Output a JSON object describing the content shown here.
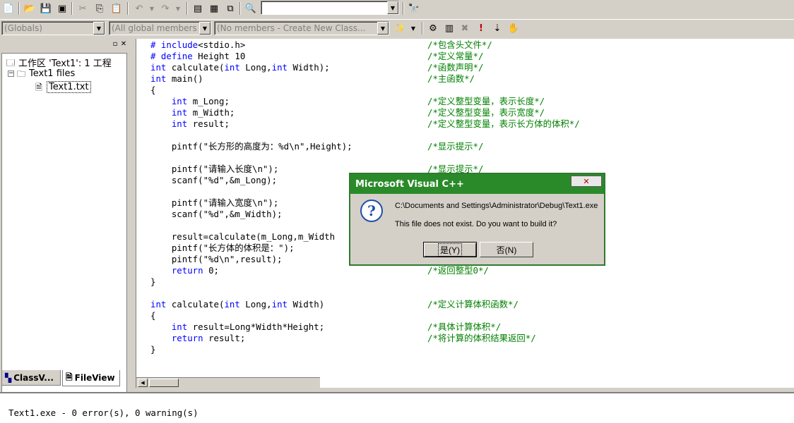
{
  "toolbar1": {
    "buttons": [
      {
        "name": "new-text-file-icon",
        "glyph": "📄"
      },
      {
        "name": "open-icon",
        "glyph": "📂"
      },
      {
        "name": "save-icon",
        "glyph": "💾"
      },
      {
        "name": "save-all-icon",
        "glyph": "▣"
      },
      {
        "name": "cut-icon",
        "glyph": "✂"
      },
      {
        "name": "copy-icon",
        "glyph": "⎘"
      },
      {
        "name": "paste-icon",
        "glyph": "📋"
      },
      {
        "name": "undo-icon",
        "glyph": "↶"
      },
      {
        "name": "redo-icon",
        "glyph": "↷"
      },
      {
        "name": "workspace-icon",
        "glyph": "▤"
      },
      {
        "name": "output-icon",
        "glyph": "▦"
      },
      {
        "name": "window-list-icon",
        "glyph": "⧉"
      },
      {
        "name": "find-in-files-icon",
        "glyph": "🔍"
      },
      {
        "name": "find-icon",
        "glyph": "🔭"
      }
    ],
    "find_combo_value": ""
  },
  "toolbar2": {
    "globals_combo": "(Globals)",
    "members_combo": "(All global members",
    "class_combo": "(No members - Create New Class...",
    "buttons": [
      {
        "name": "compile-icon",
        "glyph": "⚙"
      },
      {
        "name": "build-icon",
        "glyph": "▥"
      },
      {
        "name": "stop-build-icon",
        "glyph": "✖"
      },
      {
        "name": "execute-icon",
        "glyph": "!"
      },
      {
        "name": "go-icon",
        "glyph": "⇣"
      },
      {
        "name": "breakpoint-icon",
        "glyph": "✋"
      }
    ]
  },
  "workspace": {
    "root_label": "工作区 'Text1': 1 工程",
    "project_label": "Text1 files",
    "file_label": "Text1.txt",
    "tabs": [
      "ClassV...",
      "FileView"
    ]
  },
  "code": [
    {
      "segments": [
        {
          "t": "# include",
          "c": "kw"
        },
        {
          "t": "<stdio.h>",
          "c": ""
        }
      ],
      "comment": "/*包含头文件*/"
    },
    {
      "segments": [
        {
          "t": "# define",
          "c": "kw"
        },
        {
          "t": " Height 10",
          "c": ""
        }
      ],
      "comment": "/*定义常量*/"
    },
    {
      "segments": [
        {
          "t": "int",
          "c": "kw"
        },
        {
          "t": " calculate(",
          "c": ""
        },
        {
          "t": "int",
          "c": "kw"
        },
        {
          "t": " Long,",
          "c": ""
        },
        {
          "t": "int",
          "c": "kw"
        },
        {
          "t": " Width);",
          "c": ""
        }
      ],
      "comment": "/*函数声明*/"
    },
    {
      "segments": [
        {
          "t": "int",
          "c": "kw"
        },
        {
          "t": " main()",
          "c": ""
        }
      ],
      "comment": "/*主函数*/"
    },
    {
      "segments": [
        {
          "t": "{",
          "c": ""
        }
      ],
      "comment": ""
    },
    {
      "segments": [
        {
          "t": "    ",
          "c": ""
        },
        {
          "t": "int",
          "c": "kw"
        },
        {
          "t": " m_Long;",
          "c": ""
        }
      ],
      "comment": "/*定义整型变量，表示长度*/"
    },
    {
      "segments": [
        {
          "t": "    ",
          "c": ""
        },
        {
          "t": "int",
          "c": "kw"
        },
        {
          "t": " m_Width;",
          "c": ""
        }
      ],
      "comment": "/*定义整型变量，表示宽度*/"
    },
    {
      "segments": [
        {
          "t": "    ",
          "c": ""
        },
        {
          "t": "int",
          "c": "kw"
        },
        {
          "t": " result;",
          "c": ""
        }
      ],
      "comment": "/*定义整型变量，表示长方体的体积*/"
    },
    {
      "segments": [],
      "comment": ""
    },
    {
      "segments": [
        {
          "t": "    pintf(\"长方形的高度为：%d\\n\",Height);",
          "c": ""
        }
      ],
      "comment": "/*显示提示*/"
    },
    {
      "segments": [],
      "comment": ""
    },
    {
      "segments": [
        {
          "t": "    pintf(\"请输入长度\\n\");",
          "c": ""
        }
      ],
      "comment": "/*显示提示*/"
    },
    {
      "segments": [
        {
          "t": "    scanf(\"%d\",&m_Long);",
          "c": ""
        }
      ],
      "comment": ""
    },
    {
      "segments": [],
      "comment": ""
    },
    {
      "segments": [
        {
          "t": "    pintf(\"请输入宽度\\n\");",
          "c": ""
        }
      ],
      "comment": ""
    },
    {
      "segments": [
        {
          "t": "    scanf(\"%d\",&m_Width);",
          "c": ""
        }
      ],
      "comment": ""
    },
    {
      "segments": [],
      "comment": ""
    },
    {
      "segments": [
        {
          "t": "    result=calculate(m_Long,m_Width",
          "c": ""
        }
      ],
      "comment": ""
    },
    {
      "segments": [
        {
          "t": "    pintf(\"长方体的体积是：\");",
          "c": ""
        }
      ],
      "comment": ""
    },
    {
      "segments": [
        {
          "t": "    pintf(\"%d\\n\",result);",
          "c": ""
        }
      ],
      "comment": ""
    },
    {
      "segments": [
        {
          "t": "    ",
          "c": ""
        },
        {
          "t": "return",
          "c": "kw"
        },
        {
          "t": " 0;",
          "c": ""
        }
      ],
      "comment": "/*返回整型0*/"
    },
    {
      "segments": [
        {
          "t": "}",
          "c": ""
        }
      ],
      "comment": ""
    },
    {
      "segments": [],
      "comment": ""
    },
    {
      "segments": [
        {
          "t": "int",
          "c": "kw"
        },
        {
          "t": " calculate(",
          "c": ""
        },
        {
          "t": "int",
          "c": "kw"
        },
        {
          "t": " Long,",
          "c": ""
        },
        {
          "t": "int",
          "c": "kw"
        },
        {
          "t": " Width)",
          "c": ""
        }
      ],
      "comment": "/*定义计算体积函数*/"
    },
    {
      "segments": [
        {
          "t": "{",
          "c": ""
        }
      ],
      "comment": ""
    },
    {
      "segments": [
        {
          "t": "    ",
          "c": ""
        },
        {
          "t": "int",
          "c": "kw"
        },
        {
          "t": " result=Long*Width*Height;",
          "c": ""
        }
      ],
      "comment": "/*具体计算体积*/"
    },
    {
      "segments": [
        {
          "t": "    ",
          "c": ""
        },
        {
          "t": "return",
          "c": "kw"
        },
        {
          "t": " result;",
          "c": ""
        }
      ],
      "comment": "/*将计算的体积结果返回*/"
    },
    {
      "segments": [
        {
          "t": "}",
          "c": ""
        }
      ],
      "comment": ""
    }
  ],
  "output": {
    "text": "Text1.exe - 0 error(s), 0 warning(s)"
  },
  "dialog": {
    "title": "Microsoft Visual C++",
    "close_label": "✕",
    "icon": "?",
    "path": "C:\\Documents and Settings\\Administrator\\Debug\\Text1.exe",
    "message": "This file does not exist.  Do you want to build it?",
    "yes_label": "是(Y)",
    "no_label": "否(N)"
  }
}
